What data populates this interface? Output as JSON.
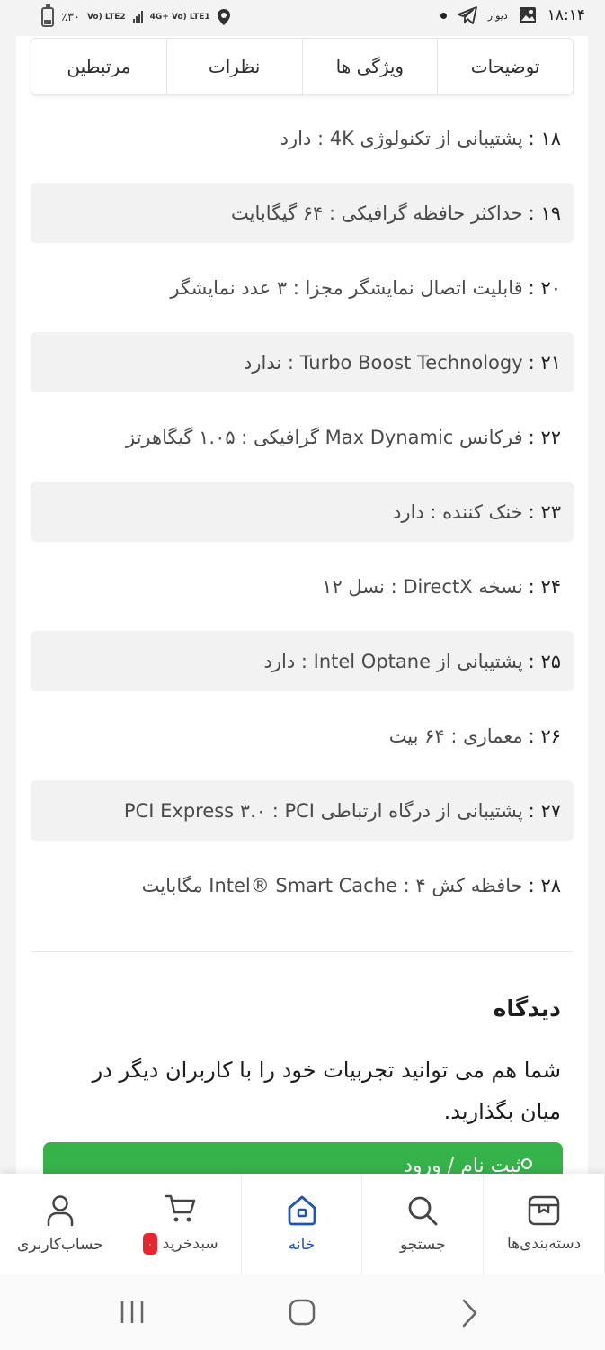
{
  "status_bar": {
    "time": "۱۸:۱۴",
    "app_badge": "دیوار",
    "battery": "٪۳۰",
    "network1": "Vo) LTE2",
    "network2": "4G+ Vo) LTE1"
  },
  "tabs": [
    "توضیحات",
    "ویژگی ها",
    "نظرات",
    "مرتبطین"
  ],
  "specs": [
    {
      "num": "۱۸ :",
      "text": "پشتیبانی از تکنولوژی 4K : دارد",
      "shaded": false
    },
    {
      "num": "۱۹ :",
      "text": "حداکثر حافظه گرافیکی : ۶۴ گیگابایت",
      "shaded": true
    },
    {
      "num": "۲۰ :",
      "text": "قابلیت اتصال نمایشگر مجزا : ۳ عدد نمایشگر",
      "shaded": false
    },
    {
      "num": "۲۱ :",
      "text": "Turbo Boost Technology : ندارد",
      "shaded": true
    },
    {
      "num": "۲۲ :",
      "text": "فرکانس Max Dynamic گرافیکی : ۱.۰۵ گیگاهرتز",
      "shaded": false
    },
    {
      "num": "۲۳ :",
      "text": "خنک کننده : دارد",
      "shaded": true
    },
    {
      "num": "۲۴ :",
      "text": "نسخه DirectX : نسل ۱۲",
      "shaded": false
    },
    {
      "num": "۲۵ :",
      "text": "پشتیبانی از Intel Optane : دارد",
      "shaded": true
    },
    {
      "num": "۲۶ :",
      "text": "معماری : ۶۴ بیت",
      "shaded": false
    },
    {
      "num": "۲۷ :",
      "text": "پشتیبانی از درگاه ارتباطی PCI Express ۳.۰ : PCI",
      "shaded": true
    },
    {
      "num": "۲۸ :",
      "text": "حافظه کش Intel® Smart Cache : ۴ مگابایت",
      "shaded": false
    }
  ],
  "review": {
    "title": "دیدگاه",
    "text": "شما هم می توانید تجربیات خود را با کاربران دیگر در میان بگذارید.",
    "signup_label": "ثبت نام / ورود"
  },
  "bottom_nav": {
    "categories": "دسته‌بندی‌ها",
    "search": "جستجو",
    "home": "خانه",
    "cart": "سبدخرید",
    "cart_count": "۰",
    "account": "حساب‌کاربری"
  },
  "colors": {
    "accent": "#1f55b8",
    "button": "#36b24a",
    "badge": "#e8262e"
  }
}
